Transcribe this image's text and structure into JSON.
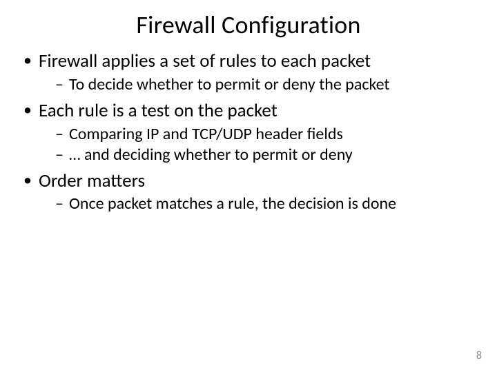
{
  "title": "Firewall Configuration",
  "bullets": [
    {
      "text": "Firewall applies a set of rules to each packet",
      "sub": [
        "To decide whether to permit or deny the packet"
      ]
    },
    {
      "text": "Each rule is a test on the packet",
      "sub": [
        "Comparing IP and TCP/UDP header fields",
        "… and deciding whether to permit or deny"
      ]
    },
    {
      "text": "Order matters",
      "sub": [
        "Once packet matches a rule, the decision is done"
      ]
    }
  ],
  "page_number": "8"
}
